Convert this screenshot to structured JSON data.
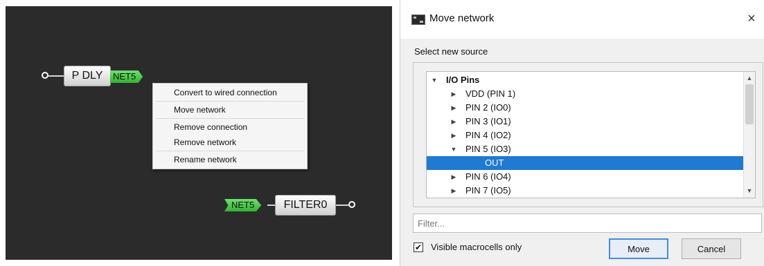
{
  "canvas": {
    "block_pdly": "P DLY",
    "block_filter": "FILTER0",
    "net_tag_top": "NET5",
    "net_tag_bottom": "NET5",
    "context_menu": [
      "Convert to wired connection",
      "Move network",
      "Remove connection",
      "Remove network",
      "Rename network"
    ]
  },
  "dialog": {
    "title": "Move network",
    "close_symbol": "×",
    "select_label": "Select new source",
    "tree": [
      {
        "label": "I/O Pins",
        "expanded": true,
        "bold": true
      },
      {
        "label": "VDD (PIN 1)",
        "expanded": false
      },
      {
        "label": "PIN 2 (IO0)",
        "expanded": false
      },
      {
        "label": "PIN 3 (IO1)",
        "expanded": false
      },
      {
        "label": "PIN 4 (IO2)",
        "expanded": false
      },
      {
        "label": "PIN 5 (IO3)",
        "expanded": true
      },
      {
        "label": "OUT",
        "selected": true
      },
      {
        "label": "PIN 6 (IO4)",
        "expanded": false
      },
      {
        "label": "PIN 7 (IO5)",
        "expanded": false
      }
    ],
    "filter_placeholder": "Filter...",
    "filter_value": "",
    "visible_macrocells_label": "Visible macrocells only",
    "visible_macrocells_checked": true,
    "move_button": "Move",
    "cancel_button": "Cancel"
  },
  "icons": {
    "app": "app-chip-icon",
    "close": "close-icon",
    "expanded": "triangle-down-icon",
    "collapsed": "triangle-right-icon",
    "scroll_up": "scroll-up-icon",
    "scroll_down": "scroll-down-icon",
    "check": "checkmark-icon"
  },
  "colors": {
    "canvas_bg": "#2b2b2b",
    "net_tag": "#3cc23c",
    "selection": "#1e7ad3",
    "default_button_border": "#3a8ee6"
  }
}
